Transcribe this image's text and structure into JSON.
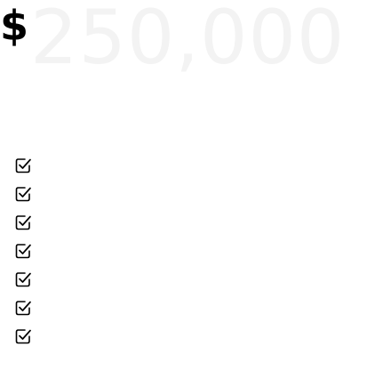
{
  "pricing": {
    "currency_symbol": "$",
    "amount": "250,000",
    "amount_color": "#f3f3f3",
    "icon_color": "#000000"
  },
  "features": {
    "icon": "check-square-icon",
    "count": 7
  }
}
